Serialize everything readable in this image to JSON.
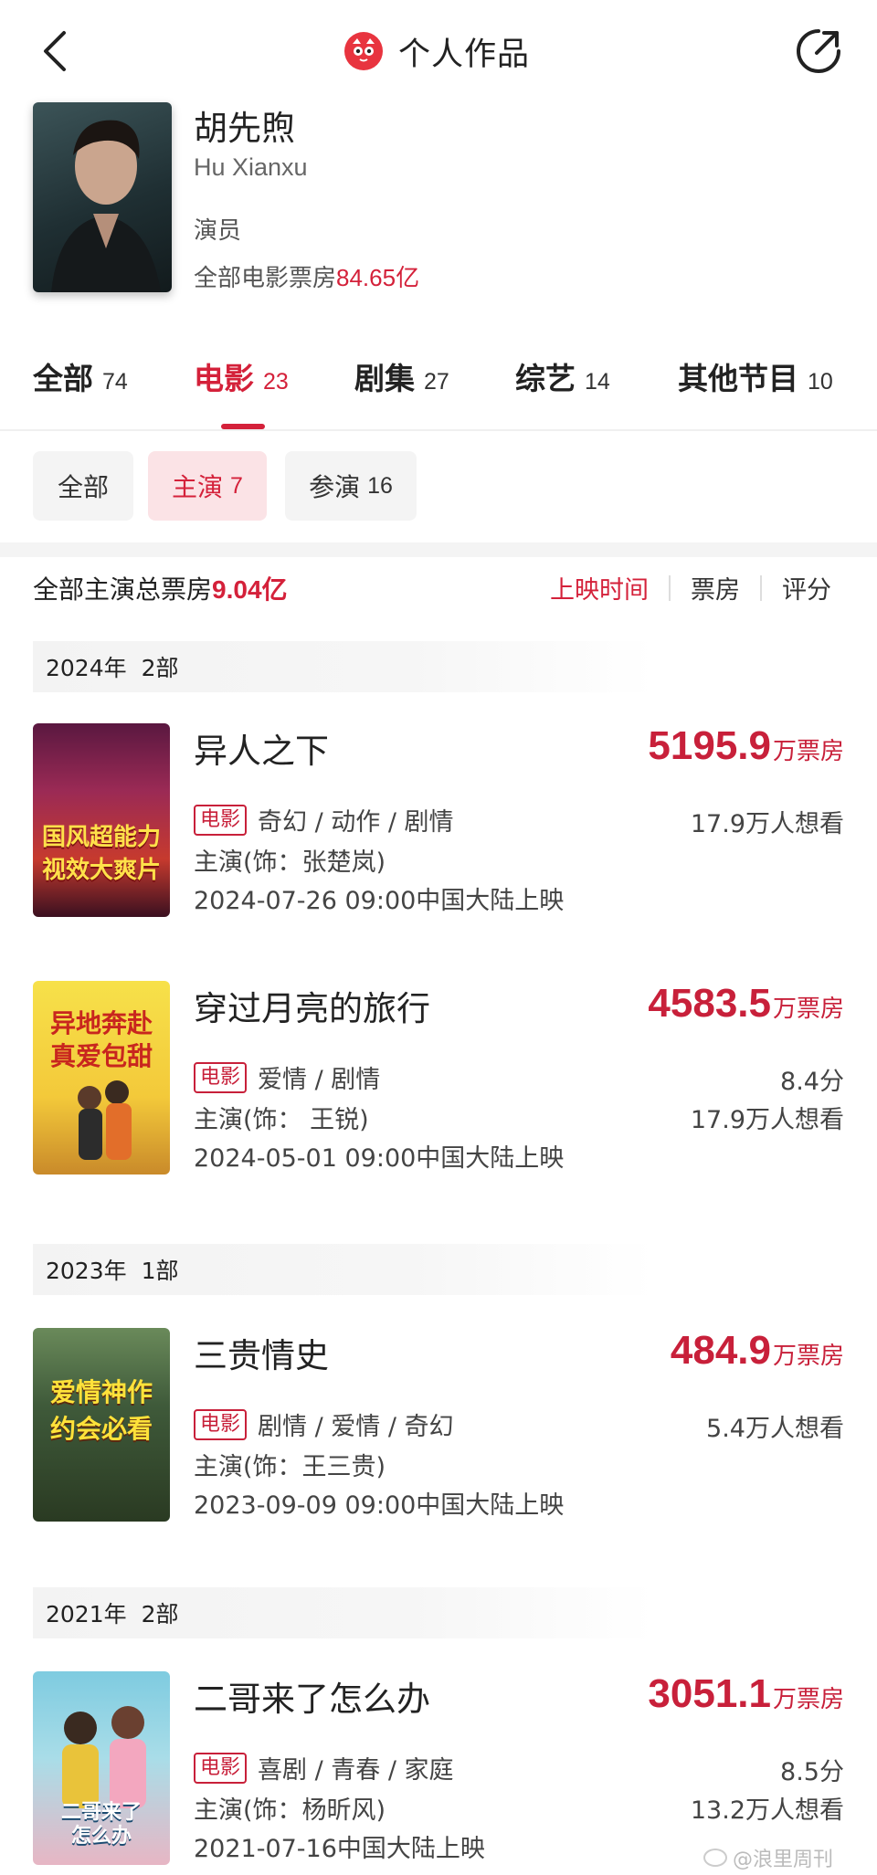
{
  "header": {
    "title": "个人作品"
  },
  "profile": {
    "name": "胡先煦",
    "name_en": "Hu Xianxu",
    "role": "演员",
    "boxoffice_label": "全部电影票房",
    "boxoffice_value": "84.65亿"
  },
  "tabs": [
    {
      "label": "全部",
      "count": "74"
    },
    {
      "label": "电影",
      "count": "23"
    },
    {
      "label": "剧集",
      "count": "27"
    },
    {
      "label": "综艺",
      "count": "14"
    },
    {
      "label": "其他节目",
      "count": "10"
    }
  ],
  "filters": [
    {
      "label": "全部",
      "count": ""
    },
    {
      "label": "主演",
      "count": "7"
    },
    {
      "label": "参演",
      "count": "16"
    }
  ],
  "summary": {
    "label": "全部主演总票房",
    "value": "9.04亿"
  },
  "sort": [
    "上映时间",
    "票房",
    "评分"
  ],
  "years": [
    {
      "year": "2024年",
      "count": "2部"
    },
    {
      "year": "2023年",
      "count": "1部"
    },
    {
      "year": "2021年",
      "count": "2部"
    }
  ],
  "movies": [
    {
      "title": "异人之下",
      "boxoffice": "5195.9",
      "unit": "万票房",
      "tag": "电影",
      "genres": "奇幻 / 动作 / 剧情",
      "role": "主演(饰：张楚岚)",
      "date": "2024-07-26 09:00中国大陆上映",
      "score": "",
      "want": "17.9万人想看",
      "poster_lines": [
        "国风超能力",
        "视效大爽片"
      ]
    },
    {
      "title": "穿过月亮的旅行",
      "boxoffice": "4583.5",
      "unit": "万票房",
      "tag": "电影",
      "genres": "爱情 / 剧情",
      "role": "主演(饰： 王锐)",
      "date": "2024-05-01 09:00中国大陆上映",
      "score": "8.4分",
      "want": "17.9万人想看",
      "poster_lines": [
        "异地奔赴",
        "真爱包甜"
      ]
    },
    {
      "title": "三贵情史",
      "boxoffice": "484.9",
      "unit": "万票房",
      "tag": "电影",
      "genres": "剧情 / 爱情 / 奇幻",
      "role": "主演(饰：王三贵)",
      "date": "2023-09-09 09:00中国大陆上映",
      "score": "",
      "want": "5.4万人想看",
      "poster_lines": [
        "爱情神作",
        "约会必看"
      ]
    },
    {
      "title": "二哥来了怎么办",
      "boxoffice": "3051.1",
      "unit": "万票房",
      "tag": "电影",
      "genres": "喜剧 / 青春 / 家庭",
      "role": "主演(饰：杨昕风)",
      "date": "2021-07-16中国大陆上映",
      "score": "8.5分",
      "want": "13.2万人想看",
      "poster_lines": [
        "二哥来了",
        "怎么办"
      ]
    }
  ],
  "watermark": "@浪里周刊",
  "colors": {
    "accent": "#d4213a",
    "price": "#c8203a",
    "chip_active_bg": "#fbe3e6"
  }
}
